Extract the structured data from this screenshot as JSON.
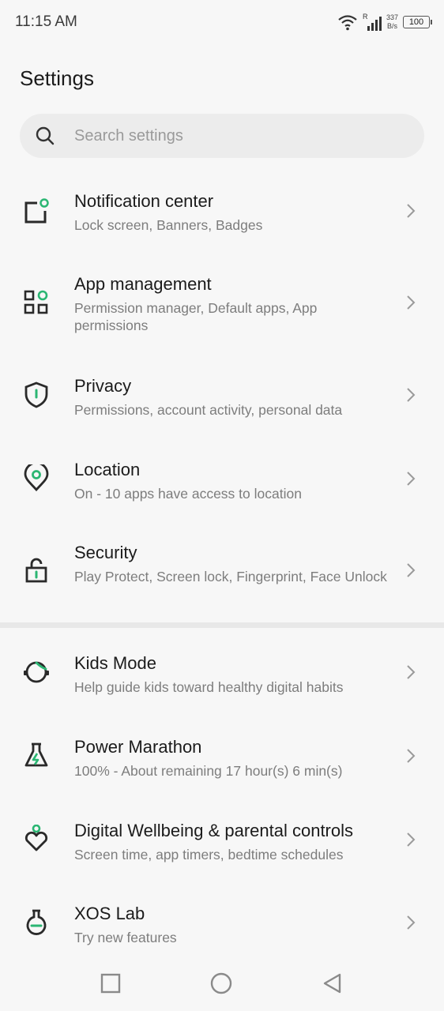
{
  "status_bar": {
    "time": "11:15 AM",
    "net_speed_value": "337",
    "net_speed_unit": "B/s",
    "network_letter": "R",
    "battery": "100"
  },
  "page": {
    "title": "Settings"
  },
  "search": {
    "placeholder": "Search settings"
  },
  "settings_items": [
    {
      "title": "Notification center",
      "subtitle": "Lock screen, Banners, Badges",
      "icon": "notification-icon"
    },
    {
      "title": "App management",
      "subtitle": "Permission manager, Default apps, App permissions",
      "icon": "apps-grid-icon"
    },
    {
      "title": "Privacy",
      "subtitle": "Permissions, account activity, personal data",
      "icon": "shield-icon"
    },
    {
      "title": "Location",
      "subtitle": "On - 10 apps have access to location",
      "icon": "location-pin-icon"
    },
    {
      "title": "Security",
      "subtitle": "Play Protect, Screen lock, Fingerprint, Face Unlock",
      "icon": "unlock-icon"
    },
    {
      "title": "Kids Mode",
      "subtitle": "Help guide kids toward healthy digital habits",
      "icon": "kids-face-icon"
    },
    {
      "title": "Power Marathon",
      "subtitle": "100% - About remaining 17 hour(s)  6 min(s)",
      "icon": "flask-bolt-icon"
    },
    {
      "title": "Digital Wellbeing & parental controls",
      "subtitle": "Screen time, app timers, bedtime schedules",
      "icon": "heart-person-icon"
    },
    {
      "title": "XOS Lab",
      "subtitle": "Try new features",
      "icon": "lab-flask-icon"
    }
  ],
  "colors": {
    "accent": "#2bb673",
    "icon_dark": "#2a2a2a",
    "background": "#f7f7f7"
  }
}
